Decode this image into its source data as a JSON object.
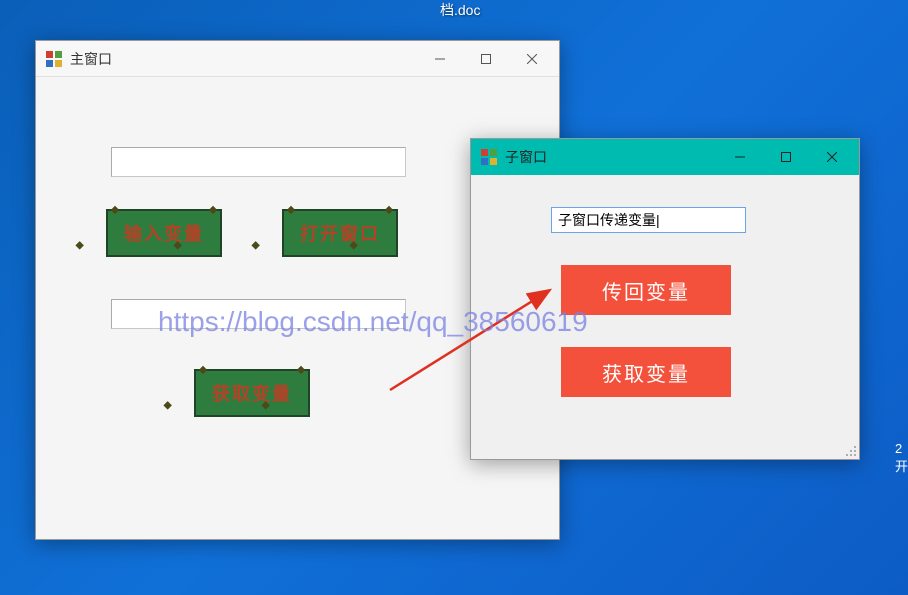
{
  "desktop": {
    "file_label_partial": "档.doc",
    "right_edge_text_1": "2",
    "right_edge_text_2": "开"
  },
  "main_window": {
    "title": "主窗口",
    "input1_value": "",
    "input2_value": "",
    "buttons": {
      "input_var": "输入变量",
      "open_window": "打开窗口",
      "get_var": "获取变量"
    }
  },
  "child_window": {
    "title": "子窗口",
    "input_value": "子窗口传递变量|",
    "buttons": {
      "return_var": "传回变量",
      "get_var": "获取变量"
    }
  },
  "watermark": "https://blog.csdn.net/qq_38560619"
}
